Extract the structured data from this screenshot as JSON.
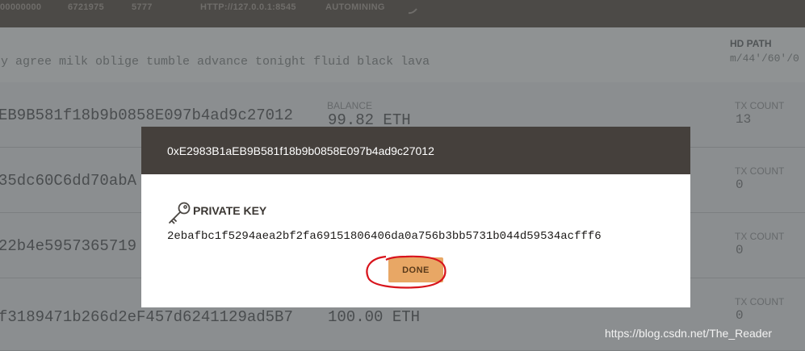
{
  "status_bar": {
    "current_block": "00000000",
    "gas_price": "6721975",
    "gas_limit": "5777",
    "rpc_server": "HTTP://127.0.0.1:8545",
    "mining_status": "AUTOMINING"
  },
  "mnemonic": {
    "words": "ey agree milk oblige tumble advance tonight fluid black lava",
    "hd_path_label": "HD PATH",
    "hd_path_value": "m/44'/60'/0"
  },
  "accounts": [
    {
      "address": "EB9B581f18b9b0858E097b4ad9c27012",
      "balance_label": "BALANCE",
      "balance": "99.82 ETH",
      "tx_count_label": "TX COUNT",
      "tx_count": "13"
    },
    {
      "address": "35dc60C6dd70abA",
      "balance_label": "",
      "balance": "",
      "tx_count_label": "TX COUNT",
      "tx_count": "0"
    },
    {
      "address": "22b4e5957365719",
      "balance_label": "",
      "balance": "",
      "tx_count_label": "TX COUNT",
      "tx_count": "0"
    },
    {
      "address": "f3189471b266d2eF457d6241129ad5B7",
      "balance_label": "",
      "balance": "100.00 ETH",
      "tx_count_label": "TX COUNT",
      "tx_count": "0"
    }
  ],
  "modal": {
    "title": "0xE2983B1aEB9B581f18b9b0858E097b4ad9c27012",
    "label": "PRIVATE KEY",
    "private_key": "2ebafbc1f5294aea2bf2fa69151806406da0a756b3bb5731b044d59534acfff6",
    "done_label": "DONE",
    "icon": "key-icon"
  },
  "annotation": {
    "color": "#d8141c"
  },
  "watermark": "https://blog.csdn.net/The_Reader"
}
